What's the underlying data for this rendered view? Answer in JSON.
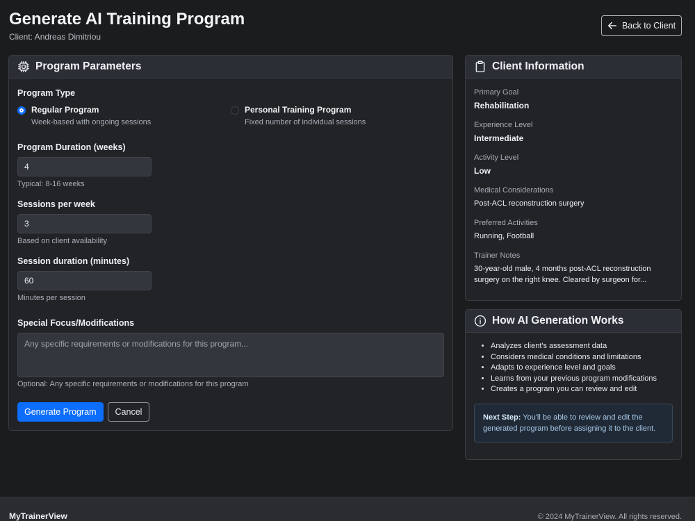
{
  "header": {
    "title": "Generate AI Training Program",
    "subtitle": "Client: Andreas Dimitriou",
    "back_label": "Back to Client"
  },
  "params": {
    "title": "Program Parameters",
    "program_type_label": "Program Type",
    "options": [
      {
        "title": "Regular Program",
        "desc": "Week-based with ongoing sessions",
        "selected": true
      },
      {
        "title": "Personal Training Program",
        "desc": "Fixed number of individual sessions",
        "selected": false
      }
    ],
    "duration": {
      "label": "Program Duration (weeks)",
      "value": "4",
      "help": "Typical: 8-16 weeks"
    },
    "sessions": {
      "label": "Sessions per week",
      "value": "3",
      "help": "Based on client availability"
    },
    "session_duration": {
      "label": "Session duration (minutes)",
      "value": "60",
      "help": "Minutes per session"
    },
    "focus": {
      "label": "Special Focus/Modifications",
      "placeholder": "Any specific requirements or modifications for this program...",
      "help": "Optional: Any specific requirements or modifications for this program"
    },
    "generate_label": "Generate Program",
    "cancel_label": "Cancel"
  },
  "client_info": {
    "title": "Client Information",
    "fields": [
      {
        "label": "Primary Goal",
        "value": "Rehabilitation",
        "bold": true
      },
      {
        "label": "Experience Level",
        "value": "Intermediate",
        "bold": true
      },
      {
        "label": "Activity Level",
        "value": "Low",
        "bold": true
      },
      {
        "label": "Medical Considerations",
        "value": "Post-ACL reconstruction surgery",
        "bold": false
      },
      {
        "label": "Preferred Activities",
        "value": "Running, Football",
        "bold": false
      },
      {
        "label": "Trainer Notes",
        "value": "30-year-old male, 4 months post-ACL reconstruction surgery on the right knee. Cleared by surgeon for...",
        "bold": false
      }
    ]
  },
  "how": {
    "title": "How AI Generation Works",
    "items": [
      "Analyzes client's assessment data",
      "Considers medical conditions and limitations",
      "Adapts to experience level and goals",
      "Learns from your previous program modifications",
      "Creates a program you can review and edit"
    ],
    "note_strong": "Next Step:",
    "note_text": "You'll be able to review and edit the generated program before assigning it to the client."
  },
  "footer": {
    "brand": "MyTrainerView",
    "copyright": "© 2024 MyTrainerView. All rights reserved."
  },
  "colors": {
    "accent": "#0d6efd",
    "background": "#1b1c1e",
    "card": "#212327"
  }
}
